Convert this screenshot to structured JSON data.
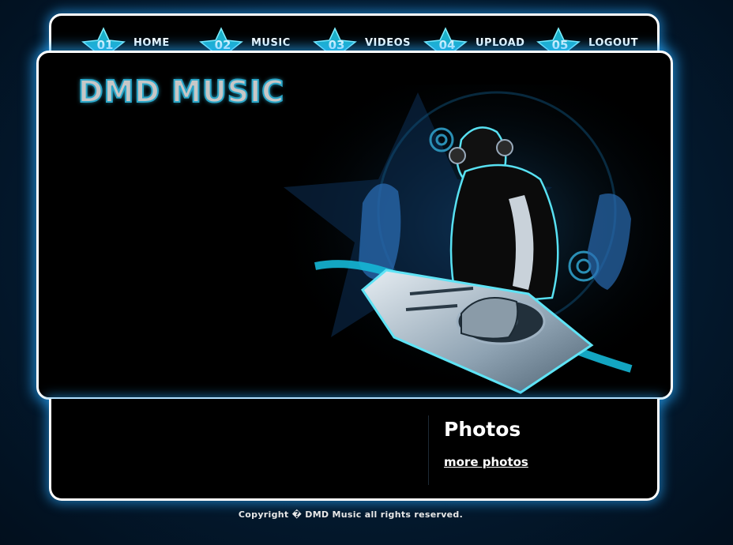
{
  "nav": {
    "items": [
      {
        "num": "01",
        "label": "HOME"
      },
      {
        "num": "02",
        "label": "MUSIC"
      },
      {
        "num": "03",
        "label": "VIDEOS"
      },
      {
        "num": "04",
        "label": "UPLOAD"
      },
      {
        "num": "05",
        "label": "LOGOUT"
      }
    ]
  },
  "header": {
    "logo_text": "DMD MUSIC"
  },
  "sidebar": {
    "heading": "Photos",
    "more_link": "more photos"
  },
  "footer": {
    "copyright": "Copyright � DMD Music all rights reserved."
  },
  "colors": {
    "accent": "#2fd3e6",
    "glow": "#28aaff",
    "background": "#041a30"
  }
}
